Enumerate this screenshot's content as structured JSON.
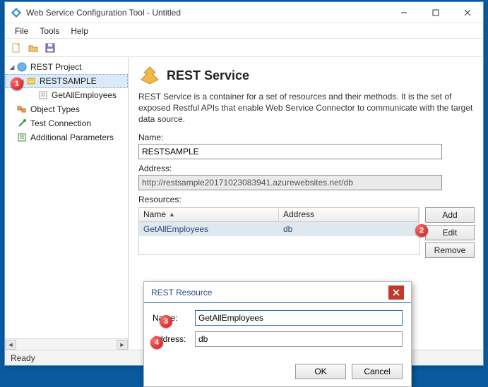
{
  "window": {
    "title": "Web Service Configuration Tool - Untitled"
  },
  "menu": {
    "file": "File",
    "tools": "Tools",
    "help": "Help"
  },
  "tree": {
    "root": "REST Project",
    "sample": "RESTSAMPLE",
    "op": "GetAllEmployees",
    "objtypes": "Object Types",
    "testconn": "Test Connection",
    "addparams": "Additional Parameters"
  },
  "main": {
    "heading": "REST Service",
    "desc": "REST Service is a container for a set of resources and their methods. It is the set of exposed Restful APIs that enable Web Service Connector to communicate with the target data source.",
    "name_label": "Name:",
    "name_value": "RESTSAMPLE",
    "address_label": "Address:",
    "address_value": "http://restsample20171023083941.azurewebsites.net/db",
    "resources_label": "Resources:",
    "col_name": "Name",
    "col_addr": "Address",
    "row1_name": "GetAllEmployees",
    "row1_addr": "db",
    "btn_add": "Add",
    "btn_edit": "Edit",
    "btn_remove": "Remove"
  },
  "popup": {
    "title": "REST Resource",
    "name_label": "Name:",
    "name_value": "GetAllEmployees",
    "addr_label": "Address:",
    "addr_value": "db",
    "ok": "OK",
    "cancel": "Cancel"
  },
  "status": {
    "text": "Ready"
  },
  "callouts": {
    "b1": "1",
    "b2": "2",
    "b3": "3",
    "b4": "4"
  }
}
